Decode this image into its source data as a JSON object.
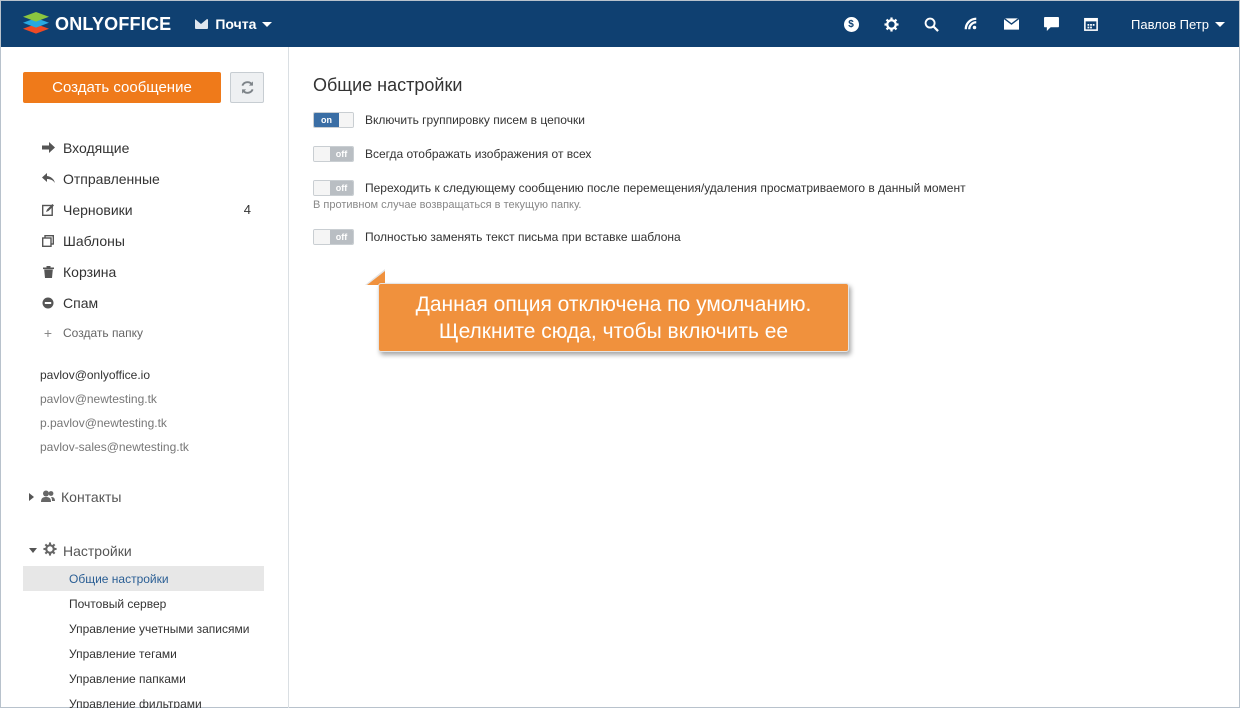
{
  "header": {
    "logo_text": "ONLYOFFICE",
    "module_label": "Почта",
    "icons": [
      "money-icon",
      "gear-icon",
      "search-icon",
      "feed-icon",
      "mail-icon",
      "chat-icon",
      "calendar-icon"
    ],
    "money_symbol": "$",
    "user_name": "Павлов Петр"
  },
  "sidebar": {
    "compose_label": "Создать сообщение",
    "folders": [
      {
        "label": "Входящие",
        "icon": "inbox-arrow-icon",
        "count": ""
      },
      {
        "label": "Отправленные",
        "icon": "sent-icon",
        "count": ""
      },
      {
        "label": "Черновики",
        "icon": "drafts-icon",
        "count": "4"
      },
      {
        "label": "Шаблоны",
        "icon": "templates-icon",
        "count": ""
      },
      {
        "label": "Корзина",
        "icon": "trash-icon",
        "count": ""
      },
      {
        "label": "Спам",
        "icon": "spam-icon",
        "count": ""
      }
    ],
    "create_folder_label": "Создать папку",
    "accounts": [
      "pavlov@onlyoffice.io",
      "pavlov@newtesting.tk",
      "p.pavlov@newtesting.tk",
      "pavlov-sales@newtesting.tk"
    ],
    "contacts_label": "Контакты",
    "settings_label": "Настройки",
    "settings_items": [
      "Общие настройки",
      "Почтовый сервер",
      "Управление учетными записями",
      "Управление тегами",
      "Управление папками",
      "Управление фильтрами"
    ]
  },
  "main": {
    "title": "Общие настройки",
    "options": [
      {
        "label": "Включить группировку писем в цепочки",
        "state": "on"
      },
      {
        "label": "Всегда отображать изображения от всех",
        "state": "off"
      },
      {
        "label": "Переходить к следующему сообщению после перемещения/удаления просматриваемого в данный момент",
        "state": "off"
      },
      {
        "label": "Полностью заменять текст письма при вставке шаблона",
        "state": "off"
      }
    ],
    "hint": "В противном случае возвращаться в текущую папку."
  },
  "callout": {
    "line1": "Данная опция отключена по умолчанию.",
    "line2": "Щелкните сюда, чтобы включить ее"
  },
  "colors": {
    "header_bg": "#0f4071",
    "compose_bg": "#ef7a1a",
    "callout_bg": "#f0913d",
    "toggle_on": "#3a6ea5",
    "active_item_text": "#2a5e94"
  }
}
